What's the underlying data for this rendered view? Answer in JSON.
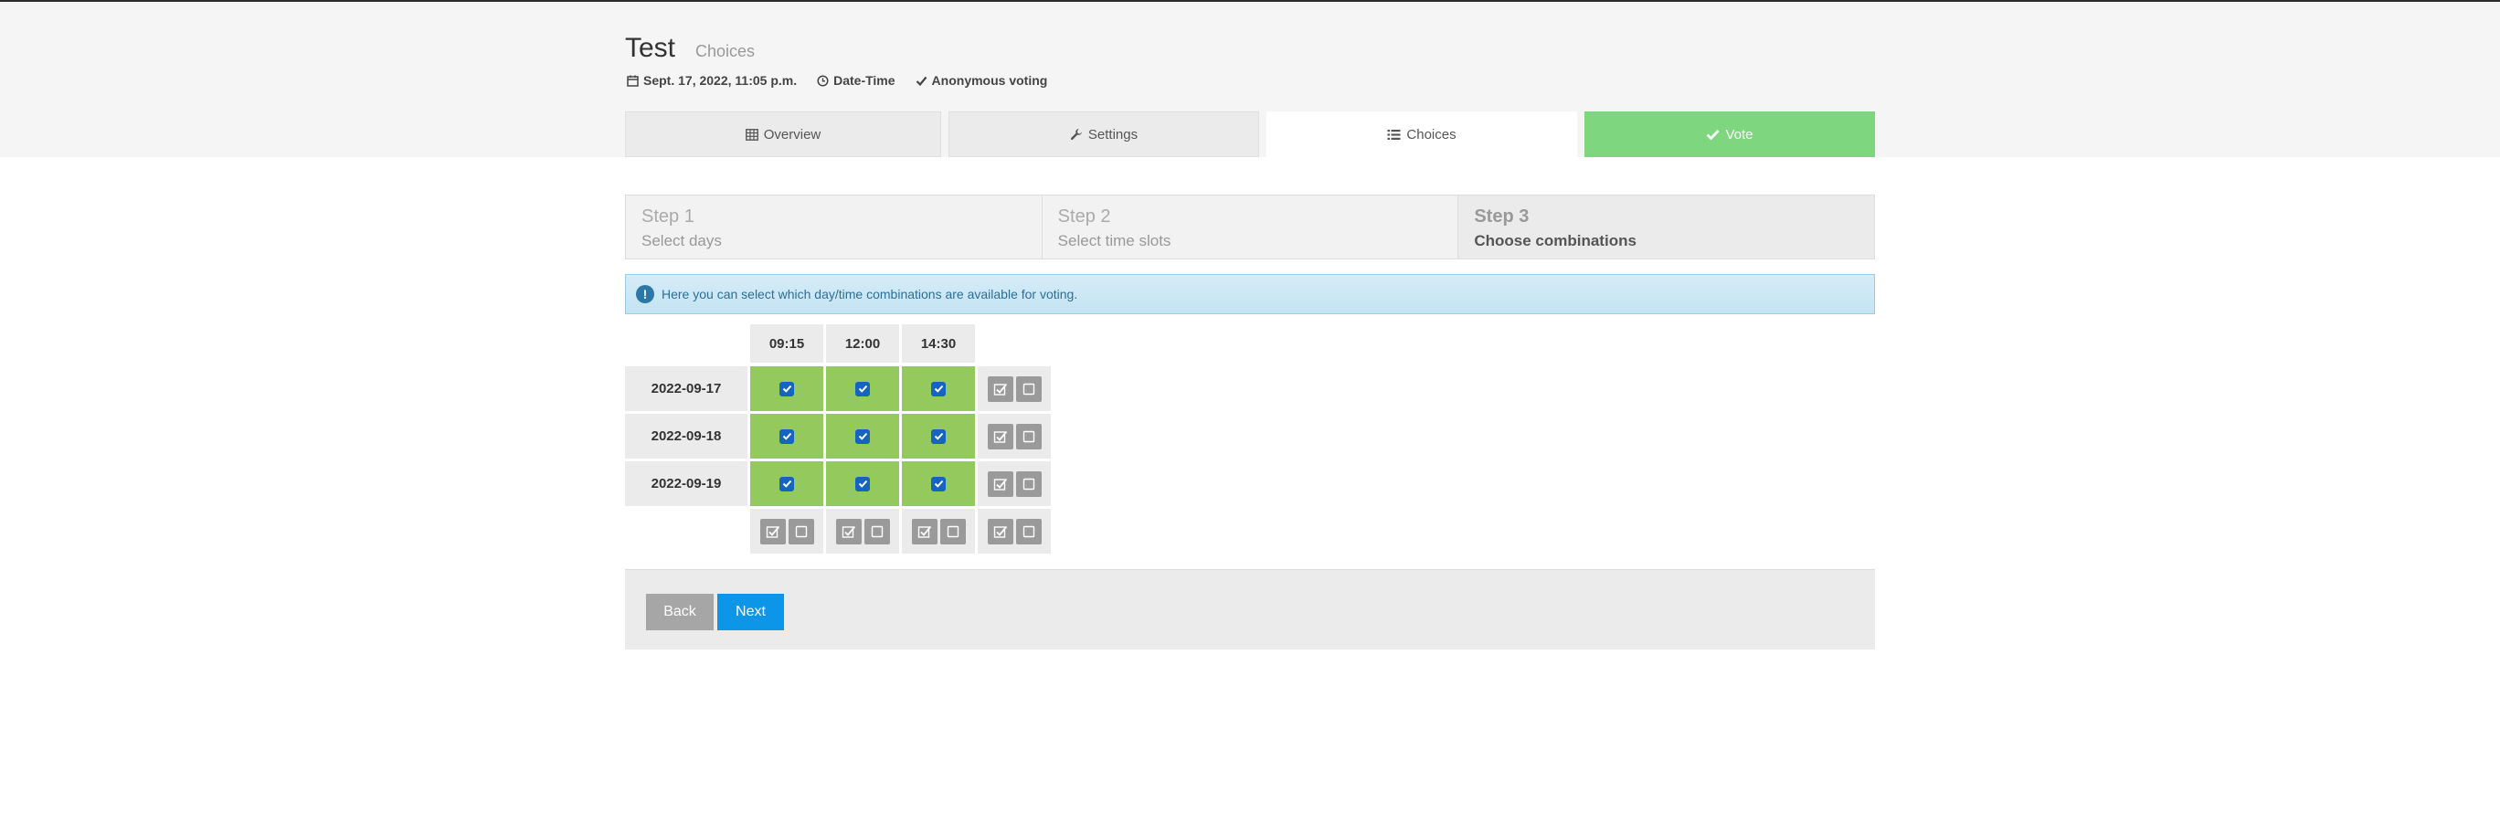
{
  "poll": {
    "title": "Test",
    "subtitle": "Choices",
    "date": "Sept. 17, 2022, 11:05 p.m.",
    "type": "Date-Time",
    "anonymity": "Anonymous voting"
  },
  "tabs": [
    {
      "label": "Overview",
      "icon": "table-icon"
    },
    {
      "label": "Settings",
      "icon": "wrench-icon"
    },
    {
      "label": "Choices",
      "icon": "list-icon",
      "active": true
    },
    {
      "label": "Vote",
      "icon": "check-icon"
    }
  ],
  "steps": [
    {
      "number": "Step 1",
      "label": "Select days"
    },
    {
      "number": "Step 2",
      "label": "Select time slots"
    },
    {
      "number": "Step 3",
      "label": "Choose combinations",
      "active": true
    }
  ],
  "alert": {
    "icon": "exclamation-icon",
    "text": "Here you can select which day/time combinations are available for voting."
  },
  "matrix": {
    "times": [
      "09:15",
      "12:00",
      "14:30"
    ],
    "dates": [
      "2022-09-17",
      "2022-09-18",
      "2022-09-19"
    ],
    "checked": [
      [
        true,
        true,
        true
      ],
      [
        true,
        true,
        true
      ],
      [
        true,
        true,
        true
      ]
    ]
  },
  "buttons": {
    "back": "Back",
    "next": "Next"
  },
  "colors": {
    "vote_tab": "#7ed67e",
    "choice_cell": "#93c95d",
    "next_button": "#0d95e8",
    "back_button": "#a6a6a6"
  }
}
